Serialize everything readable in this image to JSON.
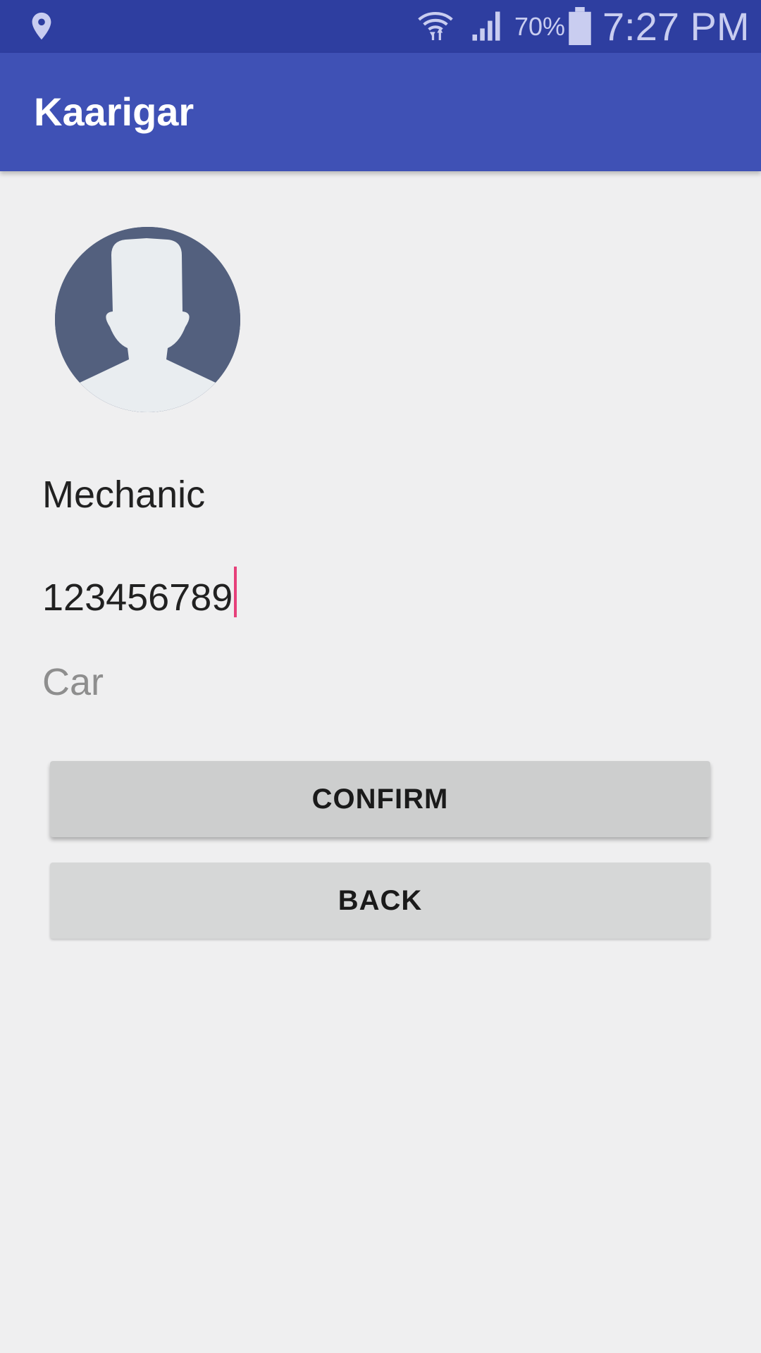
{
  "status_bar": {
    "left_icon": "location-pin-icon",
    "wifi_icon": "wifi-data-icon",
    "signal_icon": "cell-signal-icon",
    "battery_percent": "70%",
    "battery_icon": "battery-icon",
    "time": "7:27 PM"
  },
  "app_bar": {
    "title": "Kaarigar"
  },
  "profile": {
    "avatar_icon": "default-avatar-icon"
  },
  "form": {
    "profession": "Mechanic",
    "phone": "123456789",
    "vehicle_placeholder": "Car"
  },
  "actions": {
    "confirm_label": "CONFIRM",
    "back_label": "BACK"
  },
  "colors": {
    "status_bar": "#2e3ea0",
    "app_bar": "#3f51b5",
    "background": "#efeff0",
    "cursor": "#e6407a",
    "avatar_bg": "#53607e"
  }
}
